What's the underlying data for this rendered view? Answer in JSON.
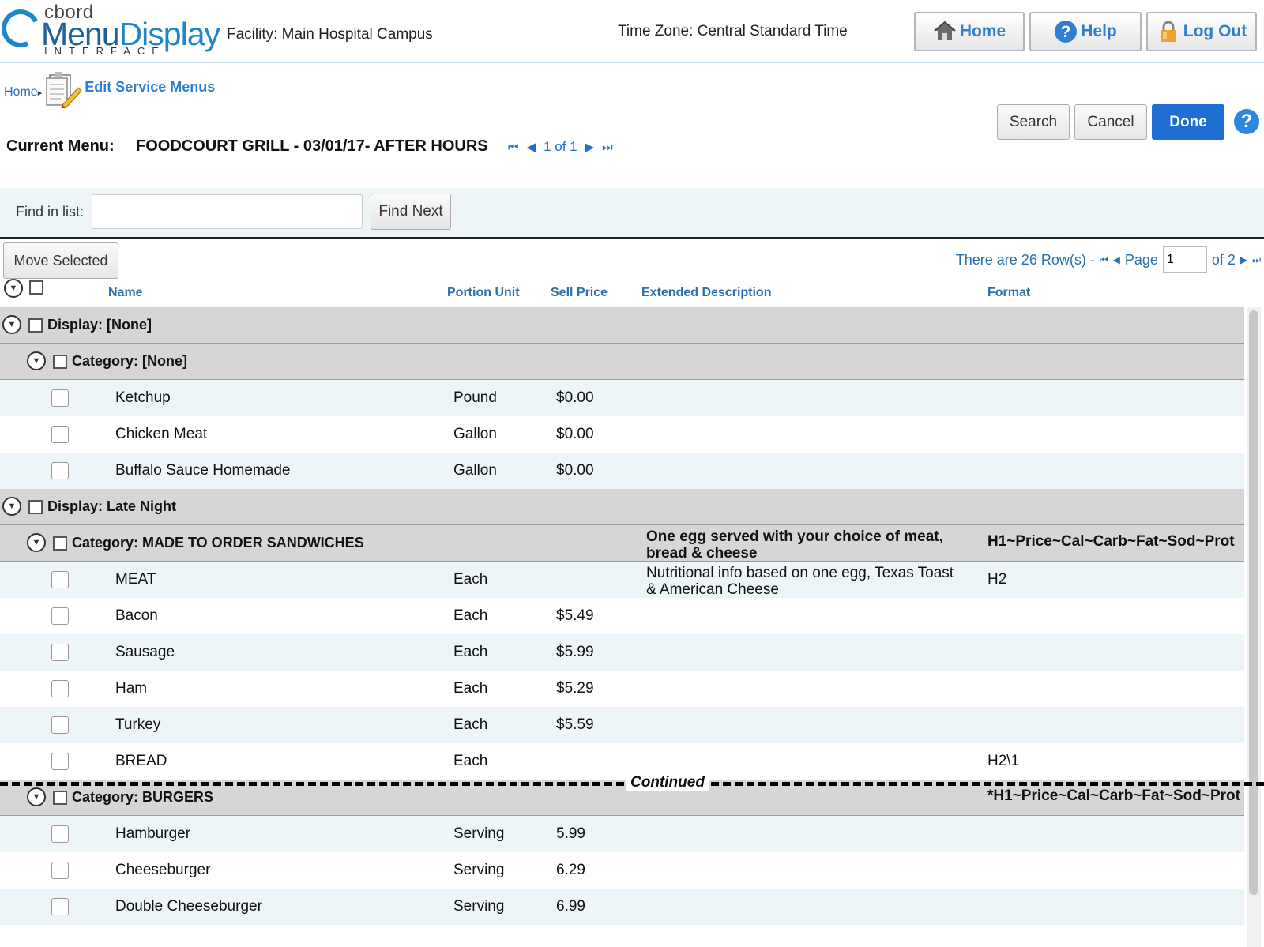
{
  "header": {
    "brand_top": "cbord",
    "brand_main_a": "Menu",
    "brand_main_b": "Display",
    "brand_sub": "INTERFACE",
    "facility": "Facility: Main Hospital Campus",
    "timezone": "Time Zone: Central Standard Time",
    "home_label": "Home",
    "help_label": "Help",
    "logout_label": "Log Out"
  },
  "breadcrumb": {
    "home": "Home",
    "separator": "▸",
    "title": "Edit Service Menus"
  },
  "actions": {
    "search": "Search",
    "cancel": "Cancel",
    "done": "Done",
    "help_glyph": "?"
  },
  "current_menu": {
    "label": "Current Menu:",
    "name": "FOODCOURT GRILL - 03/01/17- AFTER HOURS",
    "pager_text": "1 of 1"
  },
  "find": {
    "label": "Find in list:",
    "value": "",
    "placeholder": "",
    "button": "Find Next"
  },
  "toolbar": {
    "move_selected": "Move Selected",
    "rows_text": "There are  26 Row(s) -",
    "page_label": "Page",
    "page_value": "1",
    "page_of": "of 2"
  },
  "columns": {
    "name": "Name",
    "portion_unit": "Portion Unit",
    "sell_price": "Sell Price",
    "extended_description": "Extended Description",
    "format": "Format"
  },
  "rows": [
    {
      "kind": "display",
      "label": "Display: [None]"
    },
    {
      "kind": "category",
      "label": "Category: [None]",
      "desc": "",
      "format": ""
    },
    {
      "kind": "item",
      "name": "Ketchup",
      "unit": "Pound",
      "price": "$0.00",
      "desc": "",
      "format": ""
    },
    {
      "kind": "item",
      "name": "Chicken Meat",
      "unit": "Gallon",
      "price": "$0.00",
      "desc": "",
      "format": ""
    },
    {
      "kind": "item",
      "name": "Buffalo Sauce Homemade",
      "unit": "Gallon",
      "price": "$0.00",
      "desc": "",
      "format": ""
    },
    {
      "kind": "display",
      "label": "Display: Late Night"
    },
    {
      "kind": "category",
      "label": "Category: MADE TO ORDER SANDWICHES",
      "desc": "One egg served with your choice of meat, bread & cheese",
      "format": "H1~Price~Cal~Carb~Fat~Sod~Prot"
    },
    {
      "kind": "item",
      "name": "MEAT",
      "unit": "Each",
      "price": "",
      "desc": "Nutritional info based on one egg, Texas Toast & American Cheese",
      "format": "H2"
    },
    {
      "kind": "item",
      "name": "Bacon",
      "unit": "Each",
      "price": "$5.49",
      "desc": "",
      "format": ""
    },
    {
      "kind": "item",
      "name": "Sausage",
      "unit": "Each",
      "price": "$5.99",
      "desc": "",
      "format": ""
    },
    {
      "kind": "item",
      "name": "Ham",
      "unit": "Each",
      "price": "$5.29",
      "desc": "",
      "format": ""
    },
    {
      "kind": "item",
      "name": "Turkey",
      "unit": "Each",
      "price": "$5.59",
      "desc": "",
      "format": ""
    },
    {
      "kind": "item",
      "name": "BREAD",
      "unit": "Each",
      "price": "",
      "desc": "",
      "format": "H2\\1"
    },
    {
      "kind": "category",
      "label": "Category: BURGERS",
      "desc": "",
      "format": "*H1~Price~Cal~Carb~Fat~Sod~Prot"
    },
    {
      "kind": "item",
      "name": "Hamburger",
      "unit": "Serving",
      "price": "5.99",
      "desc": "",
      "format": ""
    },
    {
      "kind": "item",
      "name": "Cheeseburger",
      "unit": "Serving",
      "price": "6.29",
      "desc": "",
      "format": ""
    },
    {
      "kind": "item",
      "name": "Double Cheeseburger",
      "unit": "Serving",
      "price": "6.99",
      "desc": "",
      "format": ""
    }
  ],
  "continued_label": "Continued",
  "colors": {
    "accent": "#2f7fd0",
    "done_bg": "#1e6fd1",
    "group_bg": "#d6d6d6",
    "alt_row_bg": "#edf5f9"
  },
  "icons": {
    "home": "house-icon",
    "help": "question-circle-icon",
    "logout": "padlock-icon",
    "menu": "menu-edit-icon",
    "expand": "chevron-down-circle-icon"
  }
}
